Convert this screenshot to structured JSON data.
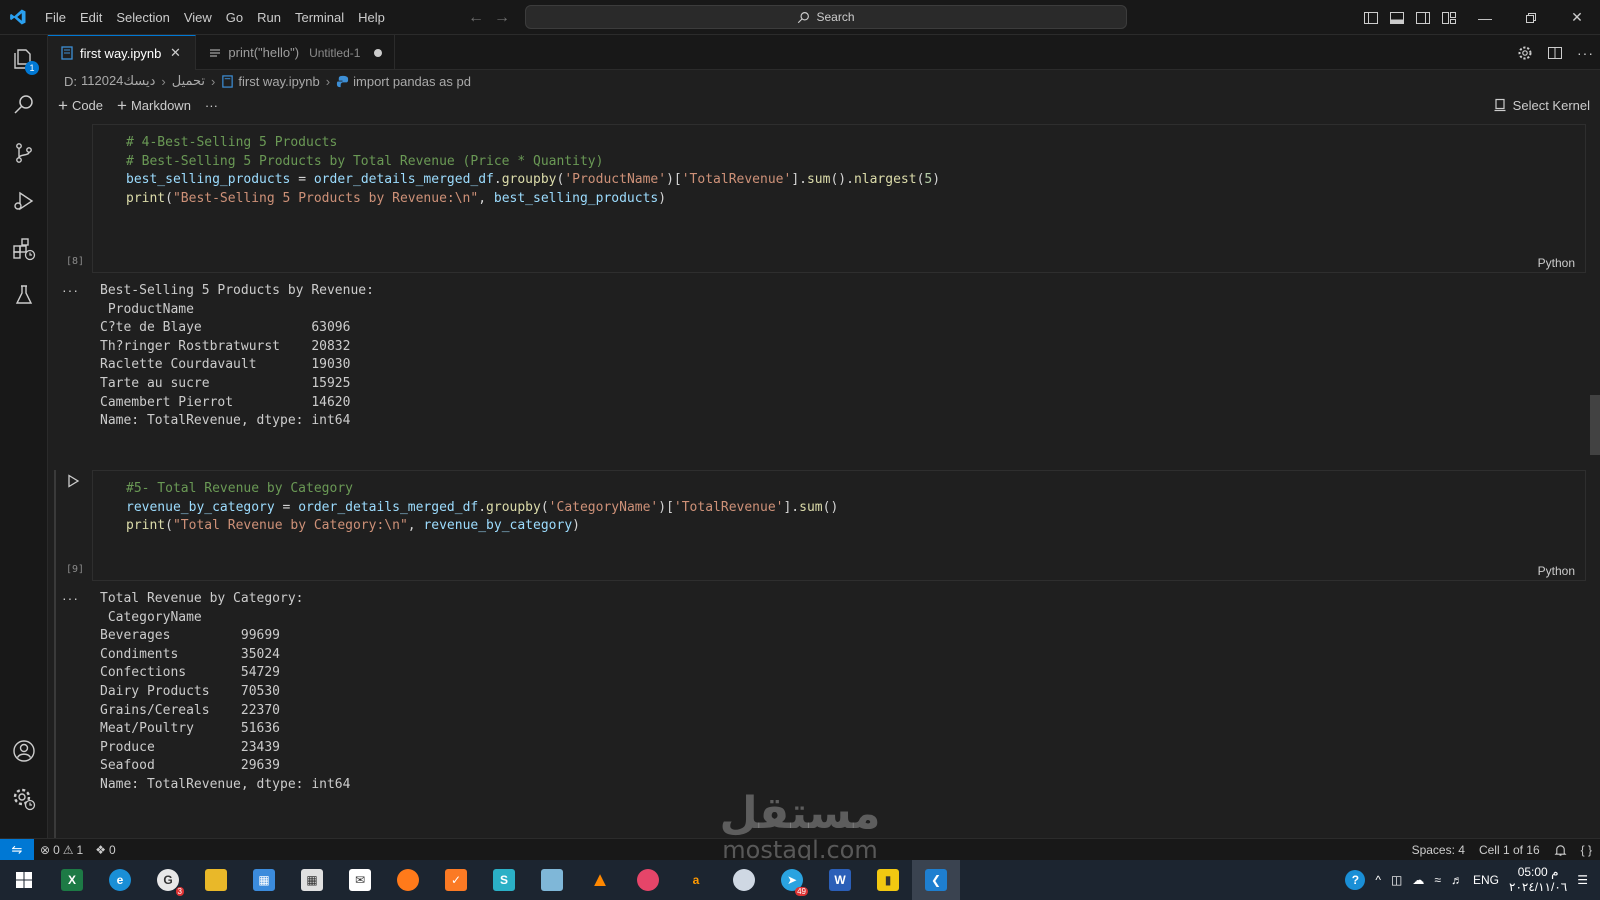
{
  "menu": [
    "File",
    "Edit",
    "Selection",
    "View",
    "Go",
    "Run",
    "Terminal",
    "Help"
  ],
  "search": {
    "label": "Search"
  },
  "activity_badge": "1",
  "tabs": [
    {
      "label": "first way.ipynb",
      "desc": ""
    },
    {
      "label": "print(\"hello\")",
      "desc": "Untitled-1"
    }
  ],
  "breadcrumb": [
    "D:",
    "112024ديسك",
    "تحميل",
    "first way.ipynb",
    "import pandas as pd"
  ],
  "toolbar": {
    "code": "Code",
    "markdown": "Markdown",
    "more": "···",
    "kernel": "Select Kernel"
  },
  "cells": [
    {
      "exec": "[8]",
      "lang": "Python",
      "output": "Best-Selling 5 Products by Revenue:\n ProductName\nC?te de Blaye              63096\nTh?ringer Rostbratwurst    20832\nRaclette Courdavault       19030\nTarte au sucre             15925\nCamembert Pierrot          14620\nName: TotalRevenue, dtype: int64"
    },
    {
      "exec": "[9]",
      "lang": "Python",
      "output": "Total Revenue by Category:\n CategoryName\nBeverages         99699\nCondiments        35024\nConfections       54729\nDairy Products    70530\nGrains/Cereals    22370\nMeat/Poultry      51636\nProduce           23439\nSeafood           29639\nName: TotalRevenue, dtype: int64"
    }
  ],
  "code1": {
    "l1": "# 4-Best-Selling 5 Products",
    "l2": "# Best-Selling 5 Products by Total Revenue (Price * Quantity)",
    "l3a": "best_selling_products",
    "l3b": " = ",
    "l3c": "order_details_merged_df",
    "l3d": ".",
    "l3e": "groupby",
    "l3f": "(",
    "l3g": "'ProductName'",
    "l3h": ")[",
    "l3i": "'TotalRevenue'",
    "l3j": "].",
    "l3k": "sum",
    "l3l": "().",
    "l3m": "nlargest",
    "l3n": "(",
    "l3o": "5",
    "l3p": ")",
    "l4a": "print",
    "l4b": "(",
    "l4c": "\"Best-Selling 5 Products by Revenue:\\n\"",
    "l4d": ", ",
    "l4e": "best_selling_products",
    "l4f": ")"
  },
  "code2": {
    "l1": "#5- Total Revenue by Category",
    "l2a": "revenue_by_category",
    "l2b": " = ",
    "l2c": "order_details_merged_df",
    "l2d": ".",
    "l2e": "groupby",
    "l2f": "(",
    "l2g": "'CategoryName'",
    "l2h": ")[",
    "l2i": "'TotalRevenue'",
    "l2j": "].",
    "l2k": "sum",
    "l2l": "()",
    "l3a": "print",
    "l3b": "(",
    "l3c": "\"Total Revenue by Category:\\n\"",
    "l3d": ", ",
    "l3e": "revenue_by_category",
    "l3f": ")"
  },
  "status": {
    "errors": "0",
    "warnings": "1",
    "ports": "0",
    "spaces": "Spaces: 4",
    "cell": "Cell 1 of 16"
  },
  "taskbar": {
    "chrome_badge": "3",
    "telegram_badge": "49",
    "lang": "ENG",
    "time": "05:00 م",
    "date": "٢٠٢٤/١١/٠٦"
  },
  "watermark": {
    "arabic": "مستقل",
    "latin": "mostaql.com"
  },
  "colors": {
    "accent": "#0078d4",
    "background": "#1f1f1f",
    "chrome": "#181818",
    "comment": "#6a9955",
    "string": "#ce9178",
    "variable": "#9cdcfe",
    "function": "#dcdcaa"
  }
}
